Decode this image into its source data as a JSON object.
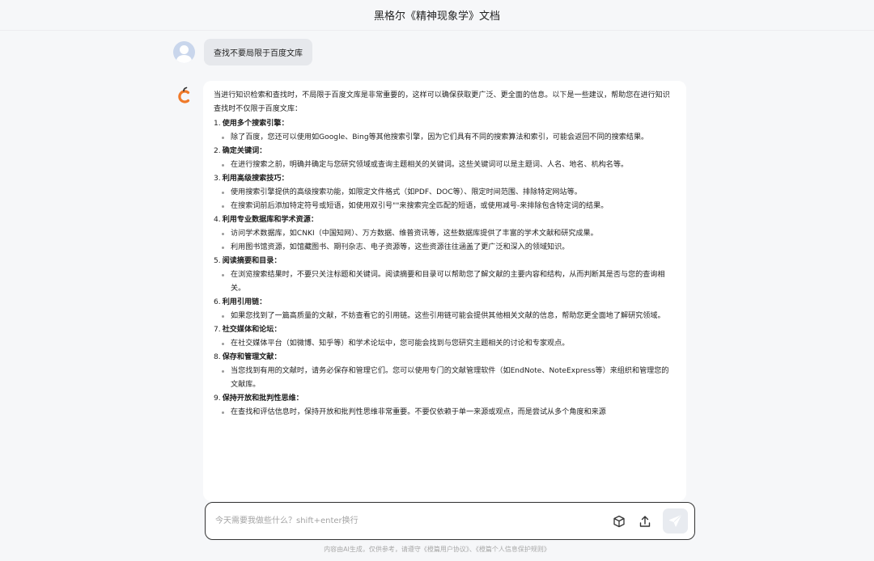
{
  "header": {
    "title": "黑格尔《精神现象学》文档"
  },
  "user_message": {
    "text": "查找不要局限于百度文库"
  },
  "answer": {
    "intro": "当进行知识检索和查找时，不局限于百度文库是非常重要的，这样可以确保获取更广泛、更全面的信息。以下是一些建议，帮助您在进行知识查找时不仅限于百度文库：",
    "sections": [
      {
        "num": "1.",
        "title": "使用多个搜索引擎：",
        "bullets": [
          "除了百度，您还可以使用如Google、Bing等其他搜索引擎，因为它们具有不同的搜索算法和索引，可能会返回不同的搜索结果。"
        ]
      },
      {
        "num": "2.",
        "title": "确定关键词：",
        "bullets": [
          "在进行搜索之前，明确并确定与您研究领域或查询主题相关的关键词。这些关键词可以是主题词、人名、地名、机构名等。"
        ]
      },
      {
        "num": "3.",
        "title": "利用高级搜索技巧：",
        "bullets": [
          "使用搜索引擎提供的高级搜索功能，如限定文件格式（如PDF、DOC等）、限定时间范围、排除特定网站等。",
          "在搜索词前后添加特定符号或短语，如使用双引号\"\"来搜索完全匹配的短语，或使用减号-来排除包含特定词的结果。"
        ]
      },
      {
        "num": "4.",
        "title": "利用专业数据库和学术资源：",
        "bullets": [
          "访问学术数据库，如CNKI（中国知网）、万方数据、维普资讯等，这些数据库提供了丰富的学术文献和研究成果。",
          "利用图书馆资源，如馆藏图书、期刊杂志、电子资源等，这些资源往往涵盖了更广泛和深入的领域知识。"
        ]
      },
      {
        "num": "5.",
        "title": "阅读摘要和目录：",
        "bullets": [
          "在浏览搜索结果时，不要只关注标题和关键词。阅读摘要和目录可以帮助您了解文献的主要内容和结构，从而判断其是否与您的查询相关。"
        ]
      },
      {
        "num": "6.",
        "title": "利用引用链：",
        "bullets": [
          "如果您找到了一篇高质量的文献，不妨查看它的引用链。这些引用链可能会提供其他相关文献的信息，帮助您更全面地了解研究领域。"
        ]
      },
      {
        "num": "7.",
        "title": "社交媒体和论坛：",
        "bullets": [
          "在社交媒体平台（如微博、知乎等）和学术论坛中，您可能会找到与您研究主题相关的讨论和专家观点。"
        ]
      },
      {
        "num": "8.",
        "title": "保存和管理文献：",
        "bullets": [
          "当您找到有用的文献时，请务必保存和管理它们。您可以使用专门的文献管理软件（如EndNote、NoteExpress等）来组织和管理您的文献库。"
        ]
      },
      {
        "num": "9.",
        "title": "保持开放和批判性思维：",
        "bullets": [
          "在查找和评估信息时，保持开放和批判性思维非常重要。不要仅依赖于单一来源或观点，而是尝试从多个角度和来源"
        ]
      }
    ]
  },
  "input": {
    "placeholder": "今天需要我做些什么？shift+enter换行",
    "value": ""
  },
  "footer": {
    "text": "内容由AI生成，仅供参考，请遵守《橙篇用户协议》、《橙篇个人信息保护规则》"
  },
  "colors": {
    "brand_orange": "#f07a2a",
    "avatar_blue": "#c9d6ec"
  },
  "icons": {
    "attach": "cube-icon",
    "upload": "upload-icon",
    "send": "send-icon"
  }
}
